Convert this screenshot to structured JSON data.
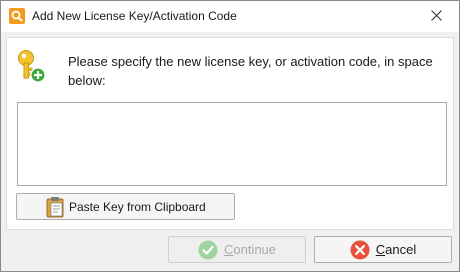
{
  "window": {
    "title": "Add New License Key/Activation Code"
  },
  "main": {
    "prompt": "Please specify the new license key, or activation code, in space below:",
    "key_value": ""
  },
  "buttons": {
    "paste": "Paste Key from Clipboard",
    "continue_first": "C",
    "continue_rest": "ontinue",
    "continue_enabled": false,
    "cancel_first": "C",
    "cancel_rest": "ancel"
  },
  "icons": {
    "app": "app-logo-icon",
    "close": "close-icon",
    "key": "key-add-icon",
    "clipboard": "clipboard-icon",
    "check": "check-icon",
    "cancel": "cancel-x-icon"
  },
  "colors": {
    "key_gold": "#f4c430",
    "add_green": "#3aa83a",
    "check_green": "#9fd39f",
    "cancel_red": "#e8503a"
  }
}
